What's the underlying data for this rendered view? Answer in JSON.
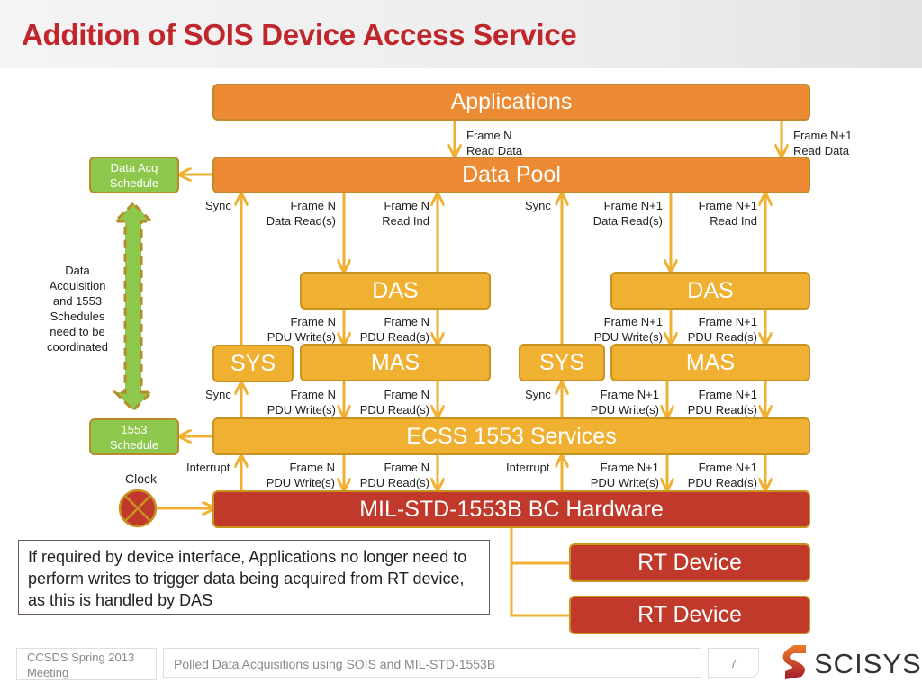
{
  "title": "Addition of SOIS Device Access Service",
  "boxes": {
    "applications": "Applications",
    "data_pool": "Data Pool",
    "data_acq_schedule": "Data Acq Schedule",
    "schedule_1553": "1553 Schedule",
    "das_left": "DAS",
    "das_right": "DAS",
    "sys_left": "SYS",
    "sys_right": "SYS",
    "mas_left": "MAS",
    "mas_right": "MAS",
    "ecss": "ECSS 1553 Services",
    "milstd": "MIL-STD-1553B BC Hardware",
    "rt_device_1": "RT Device",
    "rt_device_2": "RT Device"
  },
  "labels": {
    "app_frame_n": [
      "Frame N",
      "Read Data"
    ],
    "app_frame_n1": [
      "Frame N+1",
      "Read Data"
    ],
    "sync": "Sync",
    "interrupt": "Interrupt",
    "clock": "Clock",
    "coordination": [
      "Data",
      "Acquisition",
      "and 1553",
      "Schedules",
      "need to be",
      "coordinated"
    ],
    "n_data_reads": [
      "Frame N",
      "Data Read(s)"
    ],
    "n_read_ind": [
      "Frame N",
      "Read Ind"
    ],
    "n1_data_reads": [
      "Frame N+1",
      "Data Read(s)"
    ],
    "n1_read_ind": [
      "Frame N+1",
      "Read Ind"
    ],
    "n_pdu_write": [
      "Frame N",
      "PDU Write(s)"
    ],
    "n_pdu_read": [
      "Frame N",
      "PDU Read(s)"
    ],
    "n1_pdu_write": [
      "Frame N+1",
      "PDU Write(s)"
    ],
    "n1_pdu_read": [
      "Frame N+1",
      "PDU Read(s)"
    ]
  },
  "note": "If required by device interface, Applications no longer need to perform writes to trigger data being acquired from RT device, as this is handled by DAS",
  "footer": {
    "event": "CCSDS Spring 2013 Meeting",
    "presentation": "Polled Data Acquisitions using SOIS and MIL-STD-1553B",
    "page_number": "7",
    "logo": "SCISYS"
  },
  "colors": {
    "title": "#c0272d",
    "orange": "#ec8b33",
    "gold": "#f0b133",
    "red": "#c0392b",
    "green": "#8dc74b",
    "arrow": "#f0b133"
  }
}
